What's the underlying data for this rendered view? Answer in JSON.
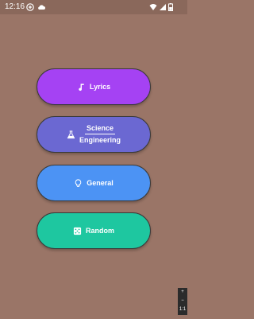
{
  "status_bar": {
    "time": "12:16"
  },
  "buttons": [
    {
      "key": "lyrics",
      "label": "Lyrics",
      "color": "#a542f3",
      "icon": "music-note-icon"
    },
    {
      "key": "science",
      "label_line1": "Science",
      "label_line2": "Engineering",
      "color": "#6b68d2",
      "icon": "flask-icon"
    },
    {
      "key": "general",
      "label": "General",
      "color": "#4c93f4",
      "icon": "lightbulb-icon"
    },
    {
      "key": "random",
      "label": "Random",
      "color": "#1ec7a0",
      "icon": "dice-icon"
    }
  ],
  "zoom": {
    "plus": "+",
    "minus": "−",
    "ratio": "1:1"
  }
}
